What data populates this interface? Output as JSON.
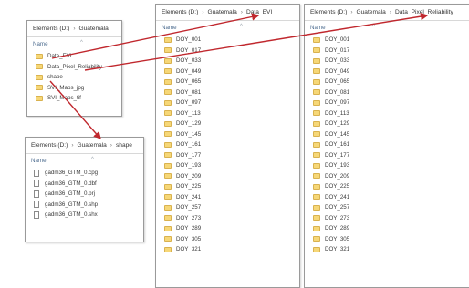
{
  "panel_guatemala": {
    "breadcrumb": [
      "Elements (D:)",
      "Guatemala"
    ],
    "column_header": "Name",
    "items": [
      "Data_EVI",
      "Data_Pixel_Reliability",
      "shape",
      "SVI_Maps_jpg",
      "SVI_Maps_tif"
    ]
  },
  "panel_shape": {
    "breadcrumb": [
      "Elements (D:)",
      "Guatemala",
      "shape"
    ],
    "column_header": "Name",
    "items": [
      "gadm36_GTM_0.cpg",
      "gadm36_GTM_0.dbf",
      "gadm36_GTM_0.prj",
      "gadm36_GTM_0.shp",
      "gadm36_GTM_0.shx"
    ]
  },
  "panel_evi": {
    "breadcrumb": [
      "Elements (D:)",
      "Guatemala",
      "Data_EVI"
    ],
    "column_header": "Name",
    "items": [
      "DOY_001",
      "DOY_017",
      "DOY_033",
      "DOY_049",
      "DOY_065",
      "DOY_081",
      "DOY_097",
      "DOY_113",
      "DOY_129",
      "DOY_145",
      "DOY_161",
      "DOY_177",
      "DOY_193",
      "DOY_209",
      "DOY_225",
      "DOY_241",
      "DOY_257",
      "DOY_273",
      "DOY_289",
      "DOY_305",
      "DOY_321"
    ]
  },
  "panel_reliability": {
    "breadcrumb": [
      "Elements (D:)",
      "Guatemala",
      "Data_Pixel_Reliability"
    ],
    "column_header": "Name",
    "items": [
      "DOY_001",
      "DOY_017",
      "DOY_033",
      "DOY_049",
      "DOY_065",
      "DOY_081",
      "DOY_097",
      "DOY_113",
      "DOY_129",
      "DOY_145",
      "DOY_161",
      "DOY_177",
      "DOY_193",
      "DOY_209",
      "DOY_225",
      "DOY_241",
      "DOY_257",
      "DOY_273",
      "DOY_289",
      "DOY_305",
      "DOY_321"
    ]
  },
  "colors": {
    "arrow": "#c0272d",
    "folder": "#f6d777"
  },
  "icons": {
    "folder": "folder-icon",
    "file": "file-icon"
  }
}
